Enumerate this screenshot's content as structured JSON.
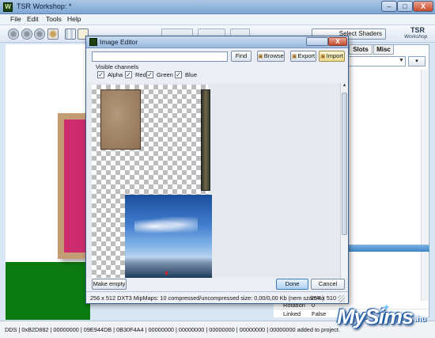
{
  "window": {
    "title": "TSR Workshop: *",
    "app_icon_glyph": "W",
    "controls": {
      "minimize": "–",
      "maximize": "□",
      "close": "X"
    }
  },
  "menu": {
    "items": [
      "File",
      "Edit",
      "Tools",
      "Help"
    ]
  },
  "toolbar": {
    "select_shaders_label": "Select Shaders",
    "logo_top": "TSR",
    "logo_bottom": "Workshop"
  },
  "right_panel": {
    "tabs": [
      "Slots",
      "Misc"
    ],
    "properties": [
      {
        "key": "Rotation",
        "value": "0"
      },
      {
        "key": "Linked",
        "value": "False"
      }
    ],
    "page_button": "▾"
  },
  "status_bar": {
    "text": "DDS | 0xB2D882 | 00000000 | 09E944DB | 0B30F4A4 | 00000000 | 00000000 | 00000000 | 00000000 | 00000000 added to project."
  },
  "watermark": {
    "text": "MySims",
    "suffix": ".hu"
  },
  "dialog": {
    "title": "Image Editor",
    "path_value": "",
    "find_label": "Find",
    "browse_label": "Browse",
    "export_label": "Export",
    "import_label": "Import",
    "channels_label": "Visible channels",
    "channels": [
      {
        "label": "Alpha",
        "checked": true
      },
      {
        "label": "Red",
        "checked": true
      },
      {
        "label": "Green",
        "checked": true
      },
      {
        "label": "Blue",
        "checked": true
      }
    ],
    "check_glyph": "✓",
    "make_empty_label": "Make empty",
    "done_label": "Done",
    "cancel_label": "Cancel",
    "status_info": "256 x 512 DXT3 MipMaps: 10 compressed/uncompressed size: 0,00/0,00 Kb (nem szám%)",
    "status_dimensions": "254 x 510"
  },
  "colors": {
    "preview_ground": "#0b7a10",
    "frame_fill": "#cc2b6e",
    "frame_border": "#c49c73"
  },
  "icons": [
    "app-logo-icon",
    "sphere-icon",
    "folder-icon",
    "image-icon",
    "chevron-down-icon",
    "resize-grip-icon"
  ]
}
